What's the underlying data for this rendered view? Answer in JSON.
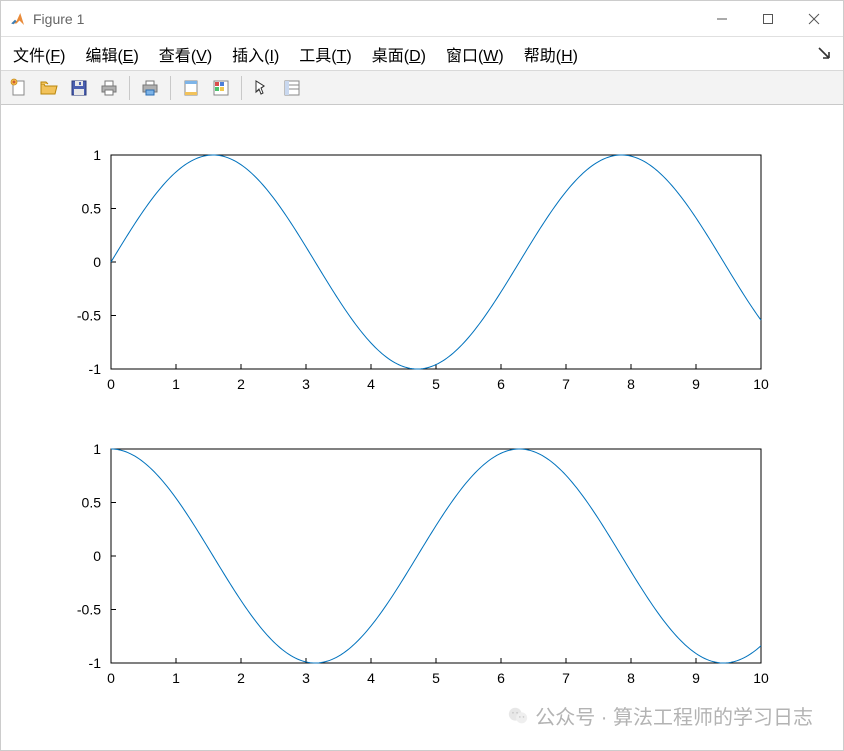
{
  "window": {
    "title": "Figure 1"
  },
  "menu": {
    "file": {
      "label": "文件",
      "key": "F"
    },
    "edit": {
      "label": "编辑",
      "key": "E"
    },
    "view": {
      "label": "查看",
      "key": "V"
    },
    "insert": {
      "label": "插入",
      "key": "I"
    },
    "tools": {
      "label": "工具",
      "key": "T"
    },
    "desktop": {
      "label": "桌面",
      "key": "D"
    },
    "window": {
      "label": "窗口",
      "key": "W"
    },
    "help": {
      "label": "帮助",
      "key": "H"
    }
  },
  "toolbar": {
    "buttons": [
      "new-figure",
      "open",
      "save",
      "print",
      "|",
      "print-preview",
      "|",
      "data-cursor",
      "colorbar",
      "|",
      "edit-plot",
      "property-editor"
    ]
  },
  "colors": {
    "line": "#0072BD"
  },
  "watermark": {
    "text": "公众号 · 算法工程师的学习日志"
  },
  "chart_data": [
    {
      "type": "line",
      "function": "sin(x)",
      "xlim": [
        0,
        10
      ],
      "ylim": [
        -1,
        1
      ],
      "xticks": [
        0,
        1,
        2,
        3,
        4,
        5,
        6,
        7,
        8,
        9,
        10
      ],
      "yticks": [
        -1,
        -0.5,
        0,
        0.5,
        1
      ],
      "xlabel": "",
      "ylabel": "",
      "title": "",
      "series": [
        {
          "name": "sin",
          "x": [
            0,
            0.5,
            1,
            1.5,
            2,
            2.5,
            3,
            3.5,
            4,
            4.5,
            5,
            5.5,
            6,
            6.5,
            7,
            7.5,
            8,
            8.5,
            9,
            9.5,
            10
          ],
          "y": [
            0,
            0.479,
            0.841,
            0.997,
            0.909,
            0.599,
            0.141,
            -0.351,
            -0.757,
            -0.978,
            -0.959,
            -0.706,
            -0.279,
            0.215,
            0.657,
            0.938,
            0.989,
            0.798,
            0.412,
            -0.075,
            -0.544
          ]
        }
      ]
    },
    {
      "type": "line",
      "function": "cos(x)",
      "xlim": [
        0,
        10
      ],
      "ylim": [
        -1,
        1
      ],
      "xticks": [
        0,
        1,
        2,
        3,
        4,
        5,
        6,
        7,
        8,
        9,
        10
      ],
      "yticks": [
        -1,
        -0.5,
        0,
        0.5,
        1
      ],
      "xlabel": "",
      "ylabel": "",
      "title": "",
      "series": [
        {
          "name": "cos",
          "x": [
            0,
            0.5,
            1,
            1.5,
            2,
            2.5,
            3,
            3.5,
            4,
            4.5,
            5,
            5.5,
            6,
            6.5,
            7,
            7.5,
            8,
            8.5,
            9,
            9.5,
            10
          ],
          "y": [
            1,
            0.878,
            0.54,
            0.071,
            -0.416,
            -0.801,
            -0.99,
            -0.936,
            -0.654,
            -0.211,
            0.284,
            0.709,
            0.96,
            0.977,
            0.754,
            0.347,
            -0.146,
            -0.602,
            -0.911,
            -0.997,
            -0.839
          ]
        }
      ]
    }
  ]
}
